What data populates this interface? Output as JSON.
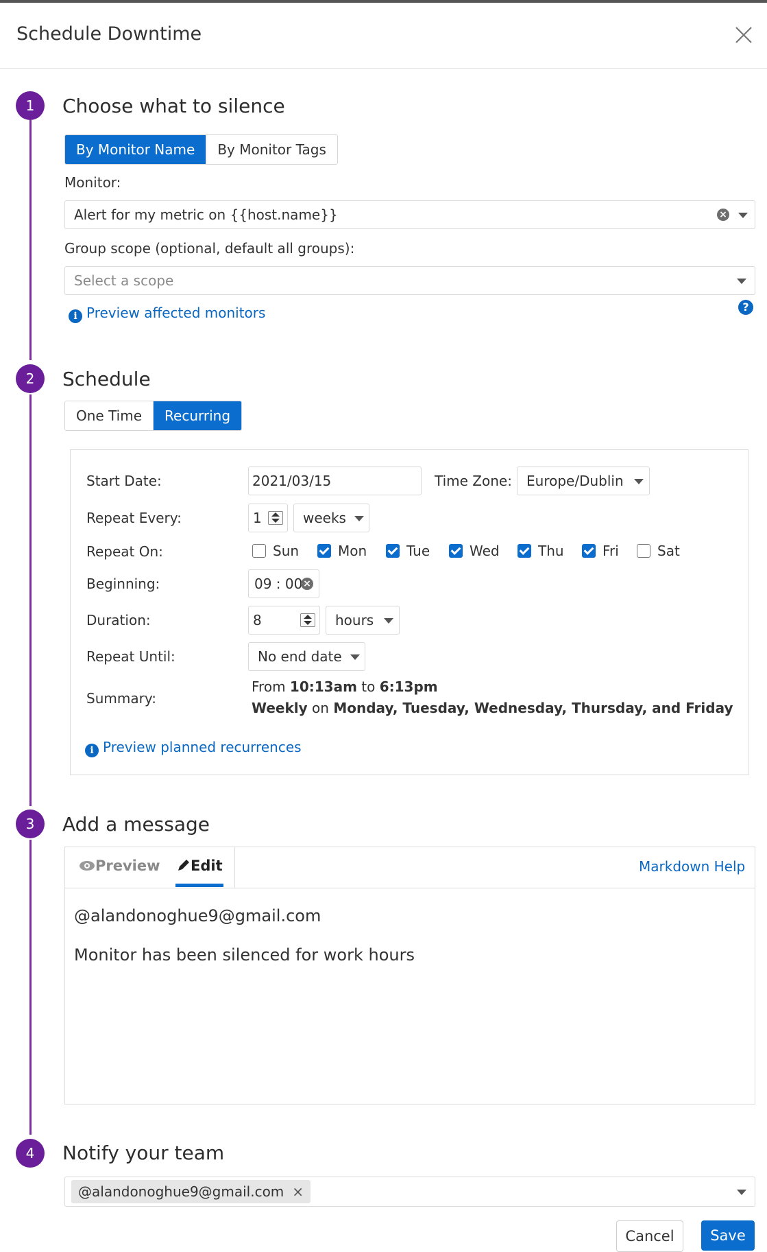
{
  "dialog": {
    "title": "Schedule Downtime"
  },
  "step1": {
    "number": "1",
    "title": "Choose what to silence",
    "tabs": [
      "By Monitor Name",
      "By Monitor Tags"
    ],
    "monitor_label": "Monitor:",
    "monitor_value": "Alert for my metric on {{host.name}}",
    "scope_label": "Group scope (optional, default all groups):",
    "scope_placeholder": "Select a scope",
    "preview_link": "Preview affected monitors"
  },
  "step2": {
    "number": "2",
    "title": "Schedule",
    "tabs": [
      "One Time",
      "Recurring"
    ],
    "start_date_label": "Start Date:",
    "start_date": "2021/03/15",
    "timezone_label": "Time Zone:",
    "timezone": "Europe/Dublin",
    "repeat_every_label": "Repeat Every:",
    "repeat_every_value": "1",
    "repeat_every_unit": "weeks",
    "repeat_on_label": "Repeat On:",
    "days": [
      {
        "label": "Sun",
        "checked": false
      },
      {
        "label": "Mon",
        "checked": true
      },
      {
        "label": "Tue",
        "checked": true
      },
      {
        "label": "Wed",
        "checked": true
      },
      {
        "label": "Thu",
        "checked": true
      },
      {
        "label": "Fri",
        "checked": true
      },
      {
        "label": "Sat",
        "checked": false
      }
    ],
    "beginning_label": "Beginning:",
    "beginning_value": "09 : 00",
    "duration_label": "Duration:",
    "duration_value": "8",
    "duration_unit": "hours",
    "repeat_until_label": "Repeat Until:",
    "repeat_until": "No end date",
    "summary_label": "Summary:",
    "summary": {
      "from": "From",
      "start": "10:13am",
      "to": "to",
      "end": "6:13pm",
      "freq": "Weekly",
      "on": "on",
      "days": "Monday, Tuesday, Wednesday, Thursday, and Friday"
    },
    "preview_link": "Preview planned recurrences"
  },
  "step3": {
    "number": "3",
    "title": "Add a message",
    "tab_preview": "Preview",
    "tab_edit": "Edit",
    "markdown_help": "Markdown Help",
    "message_line1": "@alandonoghue9@gmail.com",
    "message_line2": "Monitor has been silenced for work hours"
  },
  "step4": {
    "number": "4",
    "title": "Notify your team",
    "tag": "@alandonoghue9@gmail.com"
  },
  "footer": {
    "cancel": "Cancel",
    "save": "Save"
  },
  "colors": {
    "accent": "#0b6dce",
    "step": "#6a1e99",
    "link": "#0a67c2"
  }
}
